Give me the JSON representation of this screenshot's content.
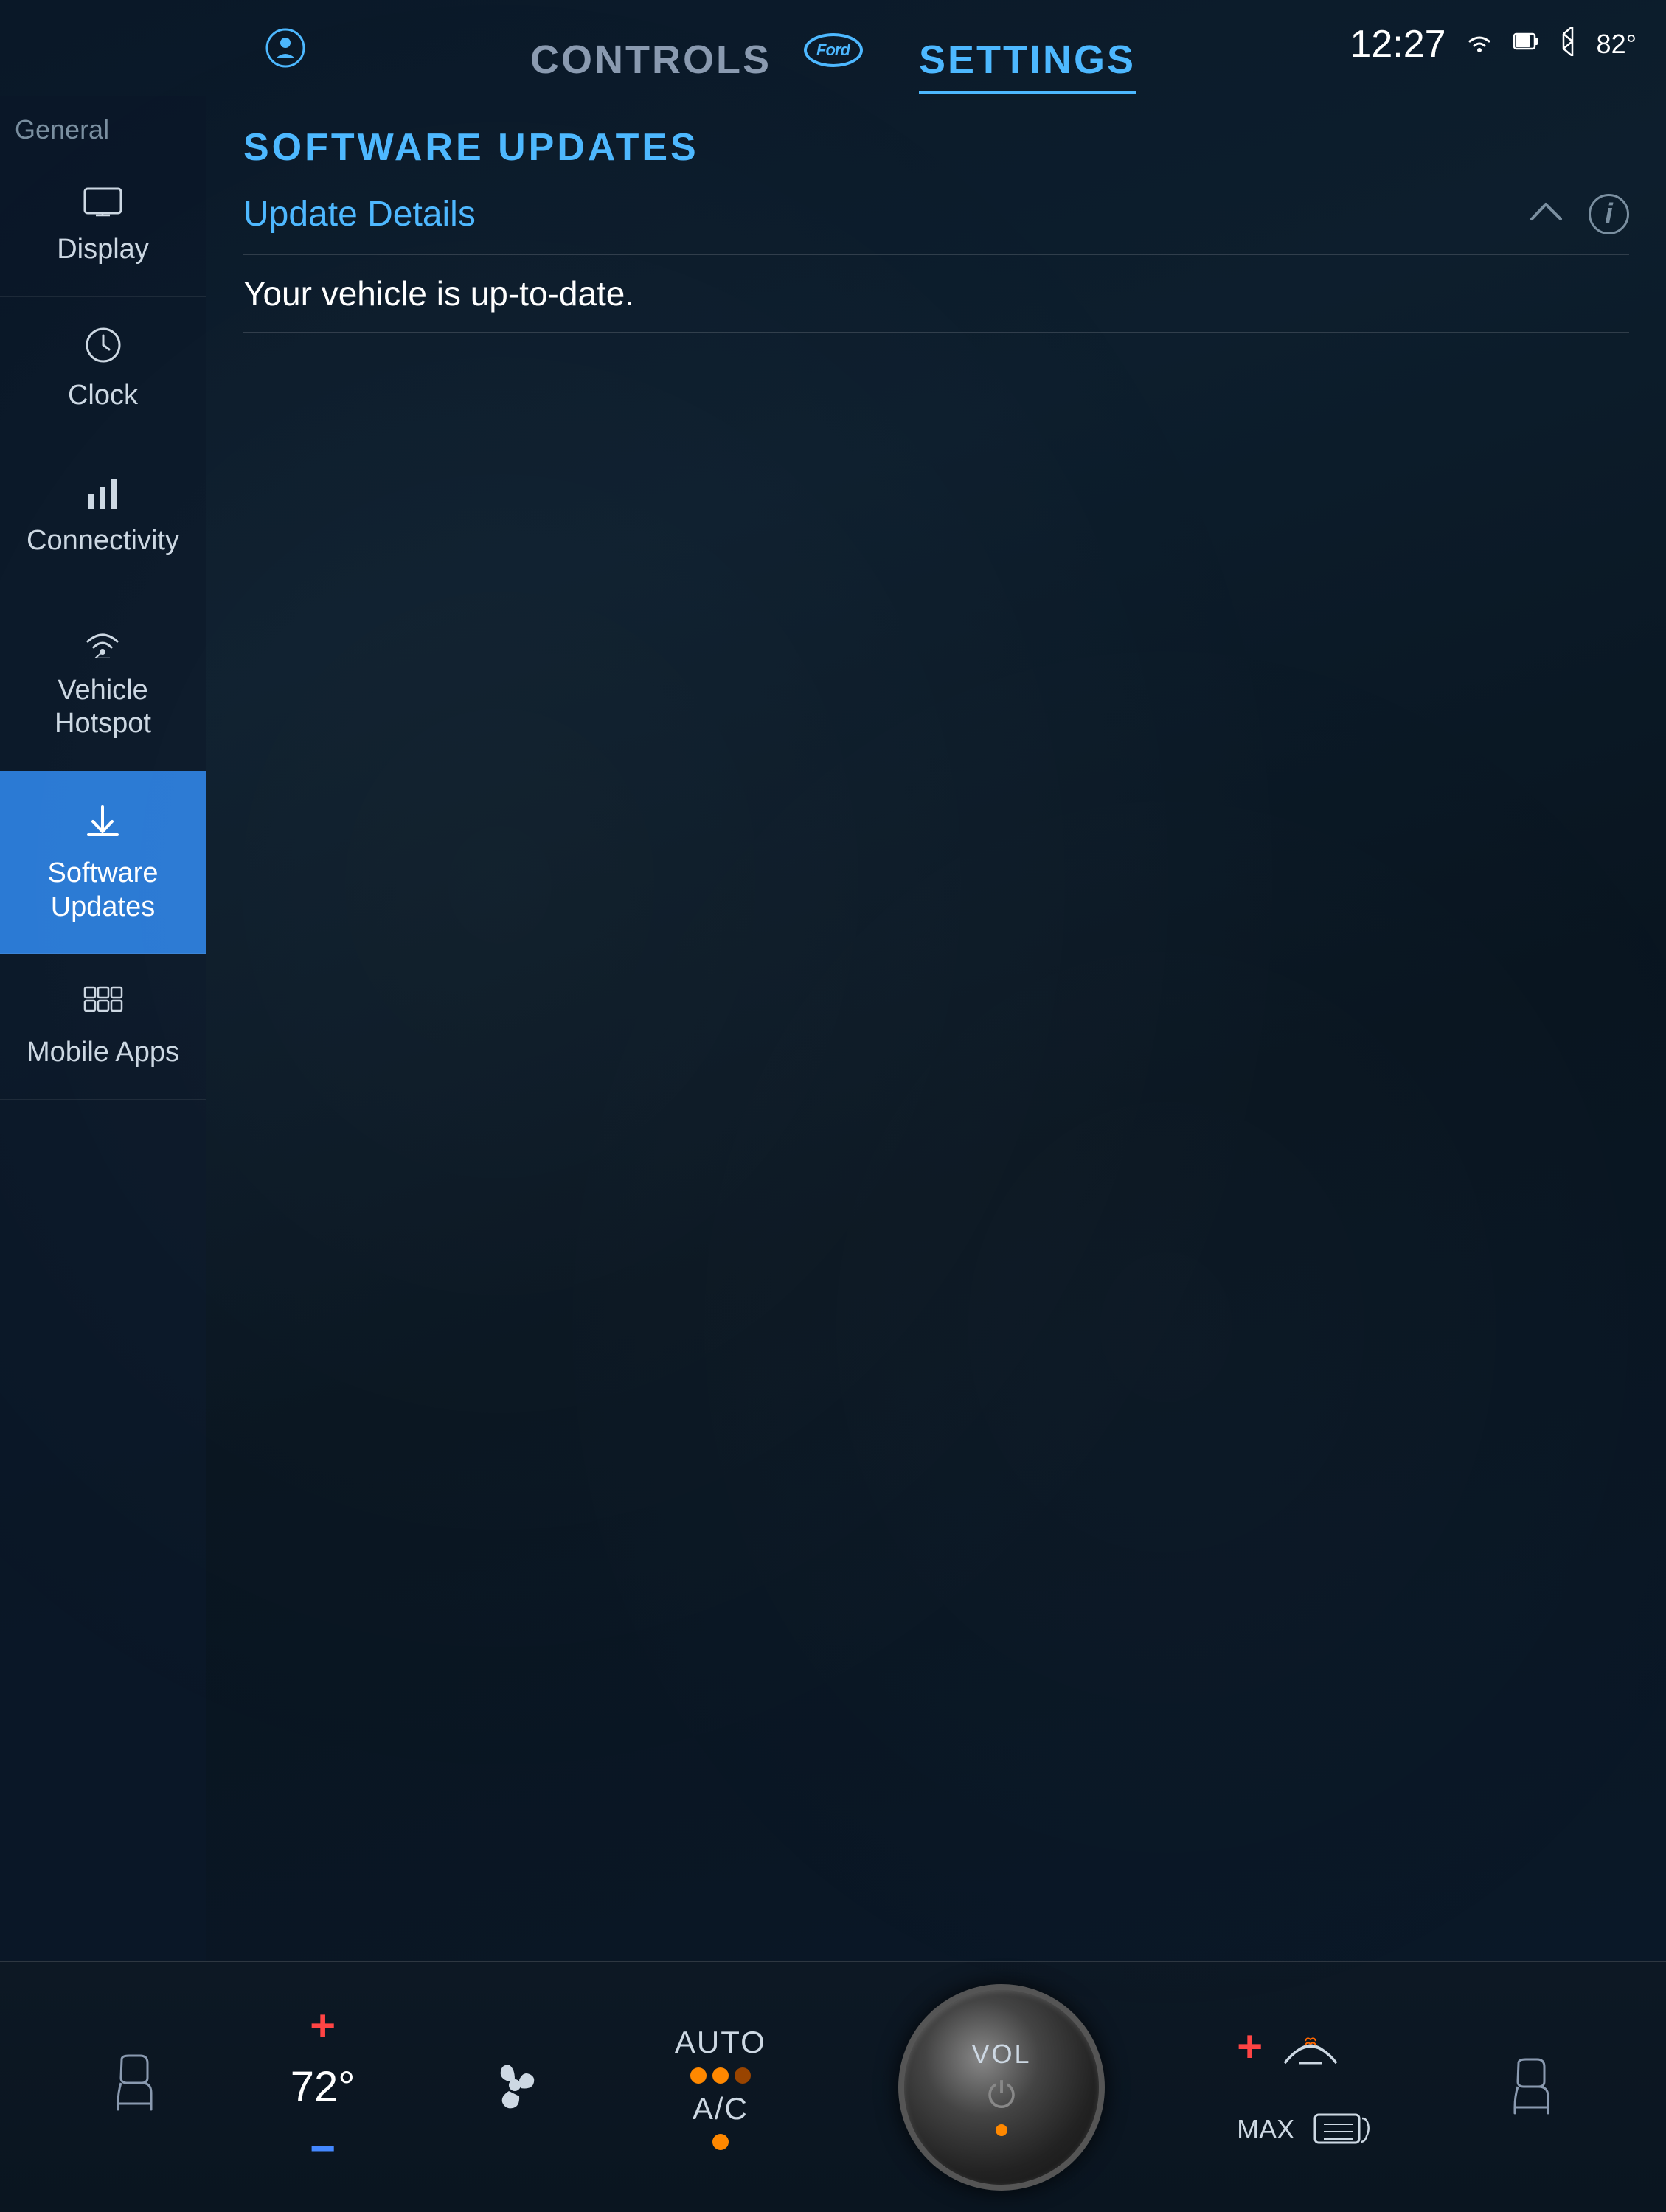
{
  "statusBar": {
    "time": "12:27",
    "temperature": "82°",
    "wifiIcon": "wifi",
    "batteryIcon": "battery",
    "bluetoothIcon": "bluetooth"
  },
  "fordLogo": "Ford",
  "alexaLabel": "⊙",
  "navTabs": [
    {
      "id": "controls",
      "label": "CONTROLS",
      "active": false
    },
    {
      "id": "settings",
      "label": "SETTINGS",
      "active": true
    }
  ],
  "sidebar": {
    "generalLabel": "General",
    "items": [
      {
        "id": "display",
        "label": "Display",
        "icon": "⬜",
        "active": false
      },
      {
        "id": "clock",
        "label": "Clock",
        "icon": "⏰",
        "active": false
      },
      {
        "id": "connectivity",
        "label": "Connectivity",
        "icon": "📶",
        "active": false
      },
      {
        "id": "vehicle-hotspot",
        "label": "Vehicle\nHotspot",
        "icon": "📡",
        "active": false
      },
      {
        "id": "software-updates",
        "label": "Software Updates",
        "icon": "⬇",
        "active": true
      },
      {
        "id": "mobile-apps",
        "label": "Mobile Apps",
        "icon": "⠿",
        "active": false
      }
    ]
  },
  "mainContent": {
    "sectionTitle": "SOFTWARE UPDATES",
    "updateDetailsTitle": "Update Details",
    "updateStatusText": "Your vehicle is up-to-date.",
    "chevronLabel": "^",
    "infoLabel": "i"
  },
  "bottomControls": {
    "tempPlus": "+",
    "tempValue": "72°",
    "tempMinus": "−",
    "autoLabel": "AUTO",
    "acLabel": "A/C",
    "volLabel": "VOL",
    "volPower": "⏻",
    "maxLabel": "MAX",
    "rightPlusLabel": "+"
  },
  "bottomIcons": [
    {
      "id": "seat-left",
      "icon": "🪑"
    },
    {
      "id": "fan",
      "icon": "✳"
    },
    {
      "id": "heat-max",
      "icon": "MAX"
    },
    {
      "id": "rear-heat",
      "icon": "R🔳"
    },
    {
      "id": "seat-right",
      "icon": "🪑"
    }
  ]
}
